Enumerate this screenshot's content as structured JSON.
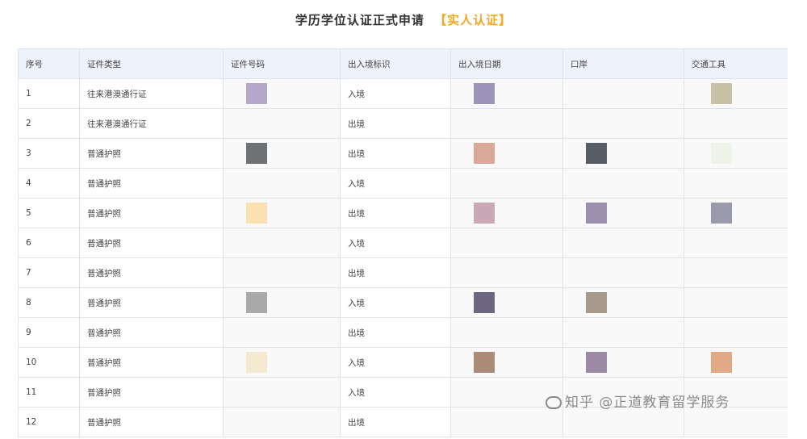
{
  "header": {
    "title": "学历学位认证正式申请",
    "tag": "【实人认证】"
  },
  "table": {
    "columns": [
      "序号",
      "证件类型",
      "证件号码",
      "出入境标识",
      "出入境日期",
      "口岸",
      "交通工具"
    ],
    "rows": [
      {
        "no": "1",
        "type": "往来港澳通行证",
        "flag": "入境"
      },
      {
        "no": "2",
        "type": "往来港澳通行证",
        "flag": "出境"
      },
      {
        "no": "3",
        "type": "普通护照",
        "flag": "出境"
      },
      {
        "no": "4",
        "type": "普通护照",
        "flag": "入境"
      },
      {
        "no": "5",
        "type": "普通护照",
        "flag": "出境"
      },
      {
        "no": "6",
        "type": "普通护照",
        "flag": "入境"
      },
      {
        "no": "7",
        "type": "普通护照",
        "flag": "出境"
      },
      {
        "no": "8",
        "type": "普通护照",
        "flag": "入境"
      },
      {
        "no": "9",
        "type": "普通护照",
        "flag": "出境"
      },
      {
        "no": "10",
        "type": "普通护照",
        "flag": "入境"
      },
      {
        "no": "11",
        "type": "普通护照",
        "flag": "入境"
      },
      {
        "no": "12",
        "type": "普通护照",
        "flag": "出境"
      }
    ]
  },
  "watermark": {
    "text": "知乎 @正道教育留学服务"
  },
  "colors": {
    "accent": "#f5a623",
    "header_bg": "#eef3fb",
    "border": "#dfe3ea"
  }
}
